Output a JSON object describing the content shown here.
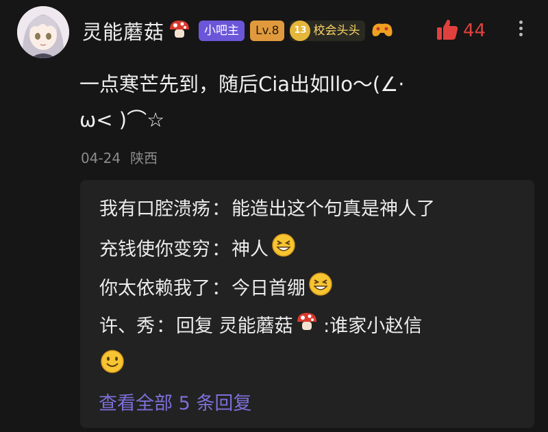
{
  "post": {
    "username": "灵能蘑菇",
    "badges": {
      "owner": "小吧主",
      "level": "Lv.8",
      "fan_level": "13",
      "fan_title": "校会头头"
    },
    "likes": "44",
    "content_line1": "一点寒芒先到，随后Cia出如llo～(∠·",
    "content_line2": "ω< )⌒☆",
    "date": "04-24",
    "location": "陕西"
  },
  "replies": [
    {
      "author": "我有口腔溃疡",
      "text": "能造出这个句真是神人了"
    },
    {
      "author": "充钱使你变穷",
      "text": "神人"
    },
    {
      "author": "你太依赖我了",
      "text": "今日首绷"
    },
    {
      "author": "许、秀",
      "text_prefix": "回复 ",
      "mention": "灵能蘑菇",
      "text": " :谁家小赵信"
    }
  ],
  "view_all": "查看全部 5 条回复",
  "icons": {
    "mushroom": "mushroom-icon",
    "like": "thumbs-up-icon",
    "more": "more-vertical-icon",
    "grin": "grinning-squint-emoji",
    "smile": "smile-emoji",
    "gamepad": "gamepad-icon"
  },
  "colors": {
    "background": "#161616",
    "owner_badge": "#6b56d9",
    "level_badge": "#e09a3d",
    "like": "#e0413f",
    "link": "#7c6fd8"
  }
}
